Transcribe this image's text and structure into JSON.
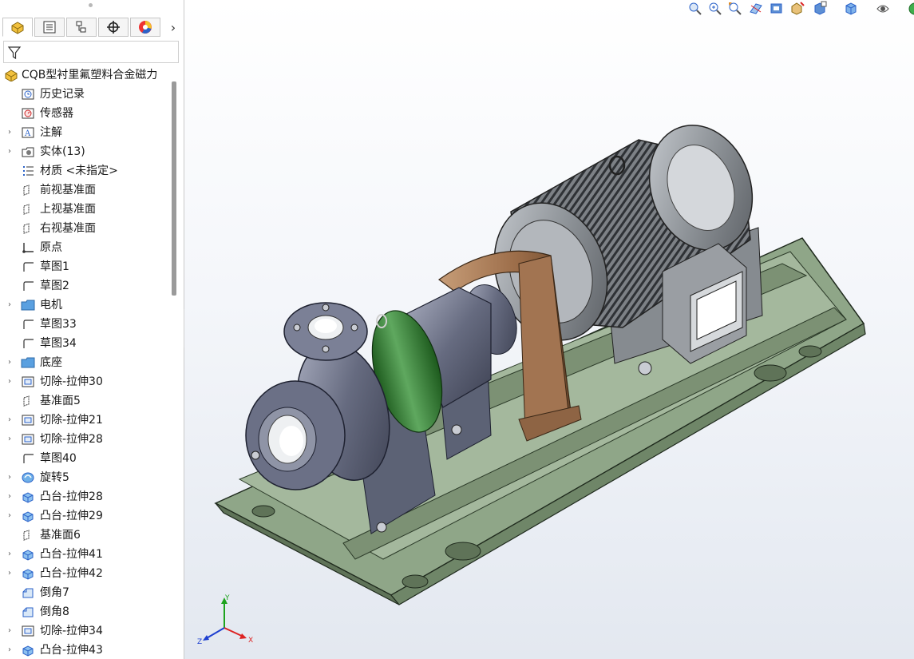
{
  "panel": {
    "tabs": [
      {
        "name": "featuremanager-tab",
        "icon": "part-icon"
      },
      {
        "name": "propertymanager-tab",
        "icon": "property-list-icon"
      },
      {
        "name": "configurationmanager-tab",
        "icon": "configuration-icon"
      },
      {
        "name": "dimxpert-tab",
        "icon": "crosshair-icon"
      },
      {
        "name": "display-manager-tab",
        "icon": "color-wheel-icon"
      }
    ],
    "more_tabs_glyph": "›",
    "filter_icon": "filter-icon",
    "tree": [
      {
        "label": "CQB型衬里氟塑料合金磁力",
        "icon": "part-icon",
        "expand": false,
        "root": true
      },
      {
        "label": "历史记录",
        "icon": "history-icon",
        "expand": false
      },
      {
        "label": "传感器",
        "icon": "sensor-icon",
        "expand": false
      },
      {
        "label": "注解",
        "icon": "annotation-icon",
        "expand": true
      },
      {
        "label": "实体(13)",
        "icon": "solid-bodies-icon",
        "expand": true
      },
      {
        "label": "材质 <未指定>",
        "icon": "material-icon",
        "expand": false
      },
      {
        "label": "前视基准面",
        "icon": "plane-icon",
        "expand": false
      },
      {
        "label": "上视基准面",
        "icon": "plane-icon",
        "expand": false
      },
      {
        "label": "右视基准面",
        "icon": "plane-icon",
        "expand": false
      },
      {
        "label": "原点",
        "icon": "origin-icon",
        "expand": false
      },
      {
        "label": "草图1",
        "icon": "sketch-icon",
        "expand": false
      },
      {
        "label": "草图2",
        "icon": "sketch-icon",
        "expand": false
      },
      {
        "label": "电机",
        "icon": "folder-icon",
        "expand": true
      },
      {
        "label": "草图33",
        "icon": "sketch-icon",
        "expand": false
      },
      {
        "label": "草图34",
        "icon": "sketch-icon",
        "expand": false
      },
      {
        "label": "底座",
        "icon": "folder-icon",
        "expand": true
      },
      {
        "label": "切除-拉伸30",
        "icon": "cut-extrude-icon",
        "expand": true
      },
      {
        "label": "基准面5",
        "icon": "plane-icon",
        "expand": false
      },
      {
        "label": "切除-拉伸21",
        "icon": "cut-extrude-icon",
        "expand": true
      },
      {
        "label": "切除-拉伸28",
        "icon": "cut-extrude-icon",
        "expand": true
      },
      {
        "label": "草图40",
        "icon": "sketch-icon",
        "expand": false
      },
      {
        "label": "旋转5",
        "icon": "revolve-icon",
        "expand": true
      },
      {
        "label": "凸台-拉伸28",
        "icon": "boss-extrude-icon",
        "expand": true
      },
      {
        "label": "凸台-拉伸29",
        "icon": "boss-extrude-icon",
        "expand": true
      },
      {
        "label": "基准面6",
        "icon": "plane-icon",
        "expand": false
      },
      {
        "label": "凸台-拉伸41",
        "icon": "boss-extrude-icon",
        "expand": true
      },
      {
        "label": "凸台-拉伸42",
        "icon": "boss-extrude-icon",
        "expand": true
      },
      {
        "label": "倒角7",
        "icon": "chamfer-icon",
        "expand": false
      },
      {
        "label": "倒角8",
        "icon": "chamfer-icon",
        "expand": false
      },
      {
        "label": "切除-拉伸34",
        "icon": "cut-extrude-icon",
        "expand": true
      },
      {
        "label": "凸台-拉伸43",
        "icon": "boss-extrude-icon",
        "expand": true
      }
    ]
  },
  "headsup_toolbar": [
    "zoom-to-fit-icon",
    "zoom-to-area-icon",
    "previous-view-icon",
    "section-view-icon",
    "dynamic-annotation-icon",
    "view-orientation-icon",
    "display-style-icon",
    "hide-show-items-icon",
    "edit-appearance-icon",
    "apply-scene-icon"
  ],
  "triad": {
    "x": "X",
    "y": "Y",
    "z": "Z"
  },
  "colors": {
    "base": "#7f9679",
    "motor": "#8f9397",
    "pump": "#5f6478",
    "guard": "#a77a55",
    "magnet": "#2f7d2f",
    "bolt": "#c9ccd3"
  }
}
